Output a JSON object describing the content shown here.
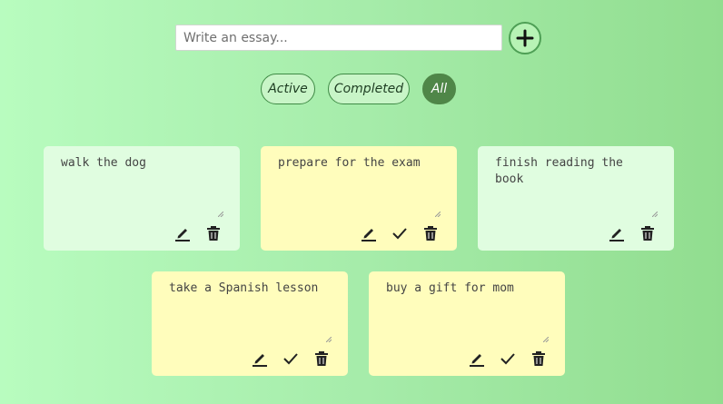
{
  "input": {
    "placeholder": "Write an essay...",
    "value": ""
  },
  "add_button": {
    "icon": "plus-icon"
  },
  "filters": [
    {
      "label": "Active",
      "selected": false
    },
    {
      "label": "Completed",
      "selected": false
    },
    {
      "label": "All",
      "selected": true
    }
  ],
  "todos": [
    {
      "text": "walk the dog",
      "completed": true,
      "color": "#e0fde0"
    },
    {
      "text": "prepare for the exam",
      "completed": false,
      "color": "#fffdbc"
    },
    {
      "text": "finish reading the book",
      "completed": true,
      "color": "#e0fde0"
    },
    {
      "text": "take a Spanish lesson",
      "completed": false,
      "color": "#fffdbc"
    },
    {
      "text": "buy a gift for mom",
      "completed": false,
      "color": "#fffdbc"
    }
  ],
  "icons": {
    "edit": "pencil-icon",
    "complete": "check-icon",
    "delete": "trash-icon"
  },
  "colors": {
    "accent": "#4f8648",
    "completed_card": "#e0fde0",
    "active_card": "#fffdbc"
  }
}
